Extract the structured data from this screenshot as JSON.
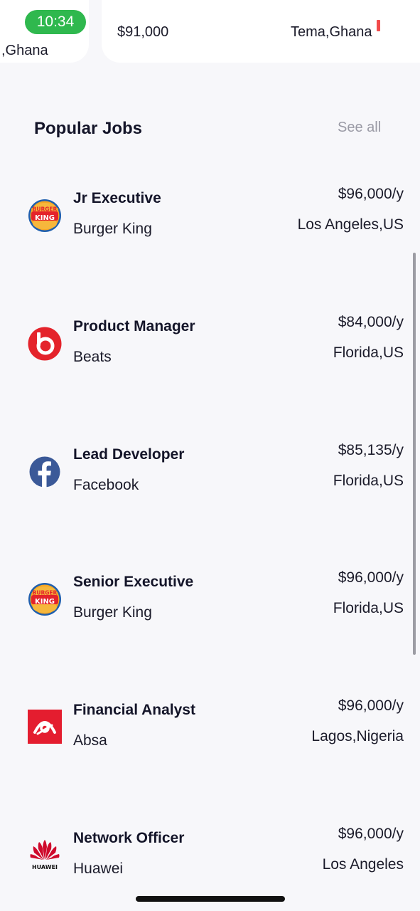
{
  "status": {
    "time": "10:34"
  },
  "featured": {
    "left_card": {
      "location": ",Ghana"
    },
    "right_card": {
      "salary": "$91,000",
      "location": "Tema,Ghana"
    }
  },
  "section": {
    "title": "Popular Jobs",
    "see_all": "See all"
  },
  "jobs": [
    {
      "title": "Jr Executive",
      "company": "Burger King",
      "salary": "$96,000/y",
      "location": "Los Angeles,US",
      "logo": "burger-king-logo"
    },
    {
      "title": "Product Manager",
      "company": "Beats",
      "salary": "$84,000/y",
      "location": "Florida,US",
      "logo": "beats-logo"
    },
    {
      "title": "Lead Developer",
      "company": "Facebook",
      "salary": "$85,135/y",
      "location": "Florida,US",
      "logo": "facebook-logo"
    },
    {
      "title": "Senior Executive",
      "company": "Burger King",
      "salary": "$96,000/y",
      "location": "Florida,US",
      "logo": "burger-king-logo"
    },
    {
      "title": "Financial Analyst",
      "company": "Absa",
      "salary": "$96,000/y",
      "location": "Lagos,Nigeria",
      "logo": "absa-logo"
    },
    {
      "title": "Network Officer",
      "company": "Huawei",
      "salary": "$96,000/y",
      "location": "Los Angeles",
      "logo": "huawei-logo"
    }
  ],
  "logo_text": {
    "burger_top": "BURGER",
    "burger_bottom": "KING",
    "huawei": "HUAWEI"
  },
  "colors": {
    "accent_green": "#2fb84e",
    "beats_red": "#e4232b",
    "facebook_blue": "#3b5998",
    "absa_red": "#e41d2f",
    "huawei_red": "#cf0a2c"
  }
}
